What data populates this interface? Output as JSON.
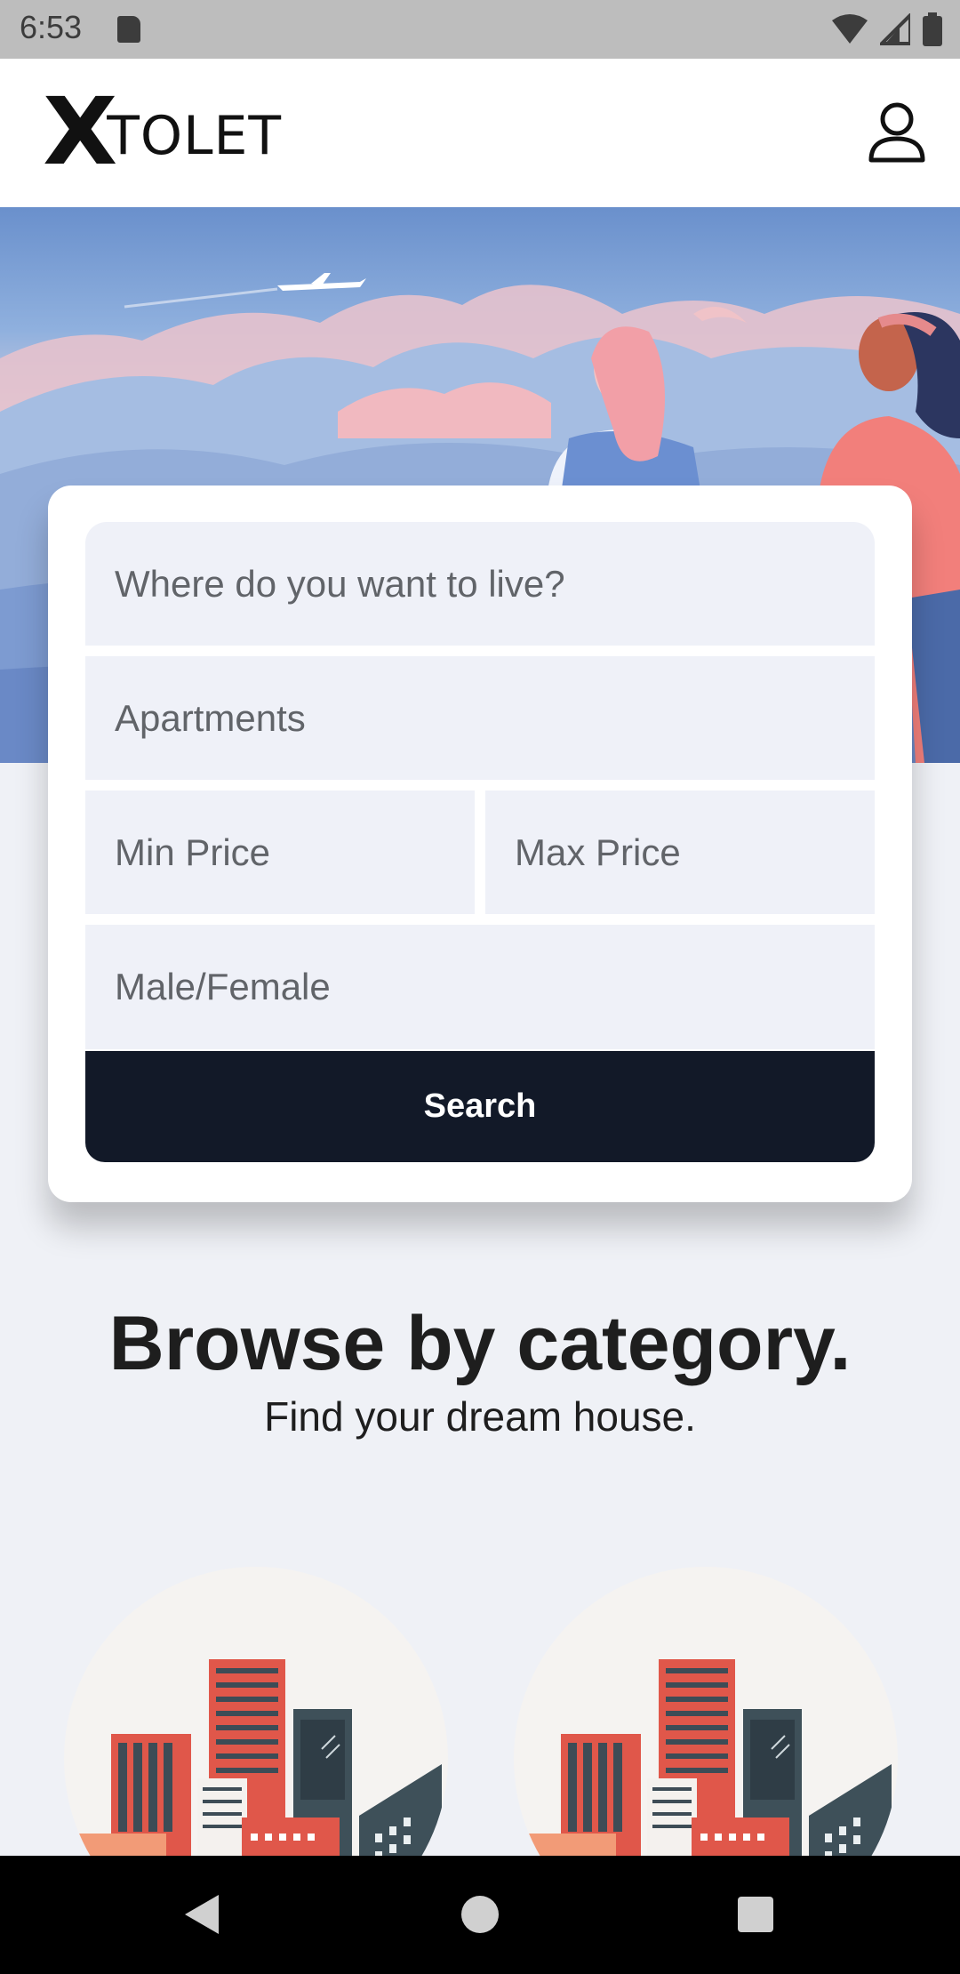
{
  "status_bar": {
    "time": "6:53",
    "icons": [
      "sd-card-icon",
      "wifi-icon",
      "signal-icon",
      "battery-icon"
    ]
  },
  "header": {
    "logo_mark": "X",
    "logo_text": "TOLET",
    "profile_icon": "person-icon"
  },
  "search_form": {
    "location_placeholder": "Where do you want to live?",
    "type_value": "Apartments",
    "min_price_placeholder": "Min Price",
    "max_price_placeholder": "Max Price",
    "gender_placeholder": "Male/Female",
    "search_label": "Search"
  },
  "browse": {
    "title": "Browse by category.",
    "subtitle": "Find your dream house."
  },
  "nav_bar": {
    "icons": [
      "back-icon",
      "home-icon",
      "recents-icon"
    ]
  },
  "colors": {
    "primary_button": "#121928",
    "field_background": "#eff1f8",
    "page_background": "#eff1f6"
  }
}
